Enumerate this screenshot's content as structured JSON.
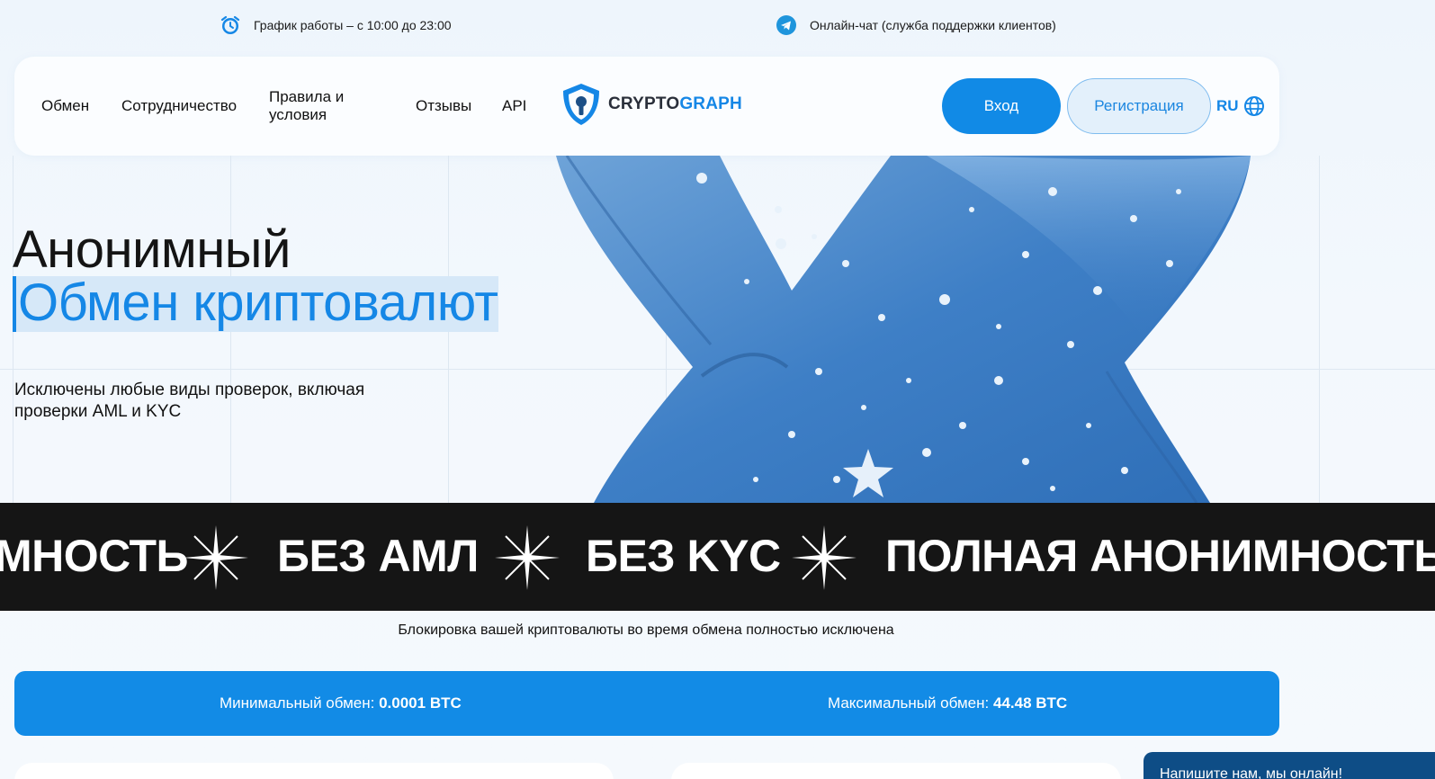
{
  "topbar": {
    "schedule": "График работы – с 10:00 до 23:00",
    "chat": "Онлайн-чат (служба поддержки клиентов)"
  },
  "nav": {
    "exchange": "Обмен",
    "partnership": "Сотрудничество",
    "rules": "Правила и условия",
    "reviews": "Отзывы",
    "api": "API"
  },
  "logo": {
    "part1": "CRYPTO",
    "part2": "GRAPH"
  },
  "auth": {
    "login": "Вход",
    "register": "Регистрация"
  },
  "lang": "RU",
  "hero": {
    "title_line1": "Анонимный",
    "title_line2": "Обмен криптовалют",
    "subtitle": "Исключены любые виды проверок, включая проверки AML и KYC"
  },
  "ticker": {
    "item1": "МНОСТЬ",
    "item2": "БЕЗ АМЛ",
    "item3": "БЕЗ KYC",
    "item4": "ПОЛНАЯ АНОНИМНОСТЬ"
  },
  "block_note": "Блокировка вашей криптовалюты во время обмена полностью исключена",
  "limits": {
    "min_label": "Минимальный обмен:",
    "min_value": "0.0001 BTC",
    "max_label": "Максимальный обмен:",
    "max_value": "44.48 BTC"
  },
  "chat_widget": "Напишите нам, мы онлайн!",
  "colors": {
    "accent": "#1587e6",
    "dark": "#151515",
    "button": "#118ae6"
  }
}
